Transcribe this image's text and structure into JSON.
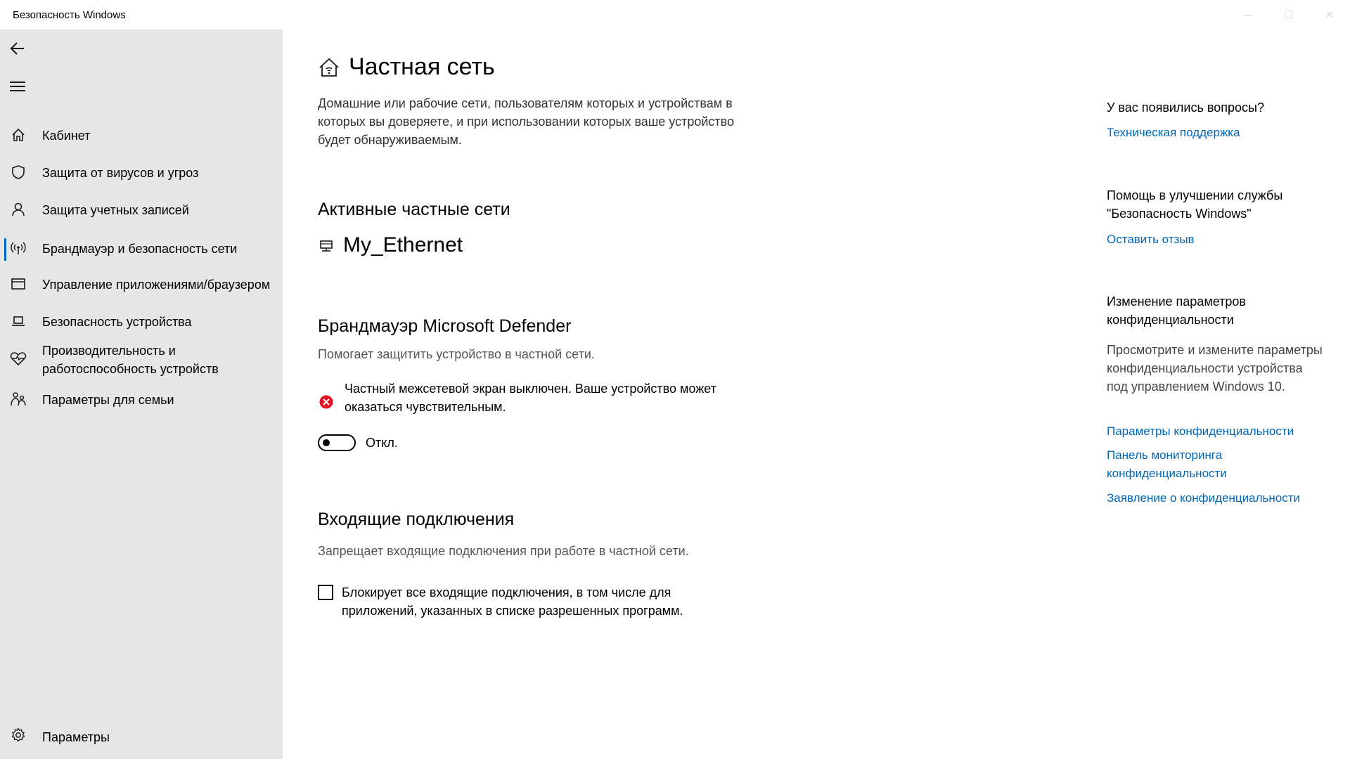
{
  "window": {
    "title": "Безопасность Windows"
  },
  "sidebar": {
    "items": [
      {
        "label": "Кабинет",
        "icon": "home-icon"
      },
      {
        "label": "Защита от вирусов и угроз",
        "icon": "shield-icon"
      },
      {
        "label": "Защита учетных записей",
        "icon": "person-icon"
      },
      {
        "label": "Брандмауэр и безопасность сети",
        "icon": "wifi-antenna-icon",
        "active": true
      },
      {
        "label": "Управление приложениями/браузером",
        "icon": "app-window-icon"
      },
      {
        "label": "Безопасность устройства",
        "icon": "laptop-icon"
      },
      {
        "label": "Производительность и работоспособность устройств",
        "icon": "heart-icon"
      },
      {
        "label": "Параметры для семьи",
        "icon": "family-icon"
      }
    ],
    "settings_label": "Параметры"
  },
  "main": {
    "title": "Частная сеть",
    "description": "Домашние или рабочие сети, пользователям которых и устройствам в которых вы доверяете, и при использовании которых ваше устройство будет обнаруживаемым.",
    "active_networks": {
      "title": "Активные частные сети",
      "network_name": "My_Ethernet"
    },
    "firewall": {
      "title": "Брандмауэр Microsoft Defender",
      "description": "Помогает защитить устройство в частной сети.",
      "warning": "Частный межсетевой экран выключен. Ваше устройство может оказаться чувствительным.",
      "toggle_label": "Откл.",
      "toggle_on": false
    },
    "incoming": {
      "title": "Входящие подключения",
      "description": "Запрещает входящие подключения при работе в частной сети.",
      "checkbox_label": "Блокирует все входящие подключения, в том числе для приложений, указанных в списке разрешенных программ.",
      "checked": false
    }
  },
  "right": {
    "questions": {
      "title": "У вас появились вопросы?",
      "link": "Техническая поддержка"
    },
    "improve": {
      "title": "Помощь в улучшении службы \"Безопасность Windows\"",
      "link": "Оставить отзыв"
    },
    "privacy": {
      "title": "Изменение параметров конфиденциальности",
      "text": "Просмотрите и измените параметры конфиденциальности устройства под управлением Windows 10.",
      "links": [
        "Параметры конфиденциальности",
        "Панель мониторинга конфиденциальности",
        "Заявление о конфиденциальности"
      ]
    }
  },
  "colors": {
    "accent": "#0067b8",
    "error": "#e81123",
    "sidebar_bg": "#e6e6e6"
  }
}
